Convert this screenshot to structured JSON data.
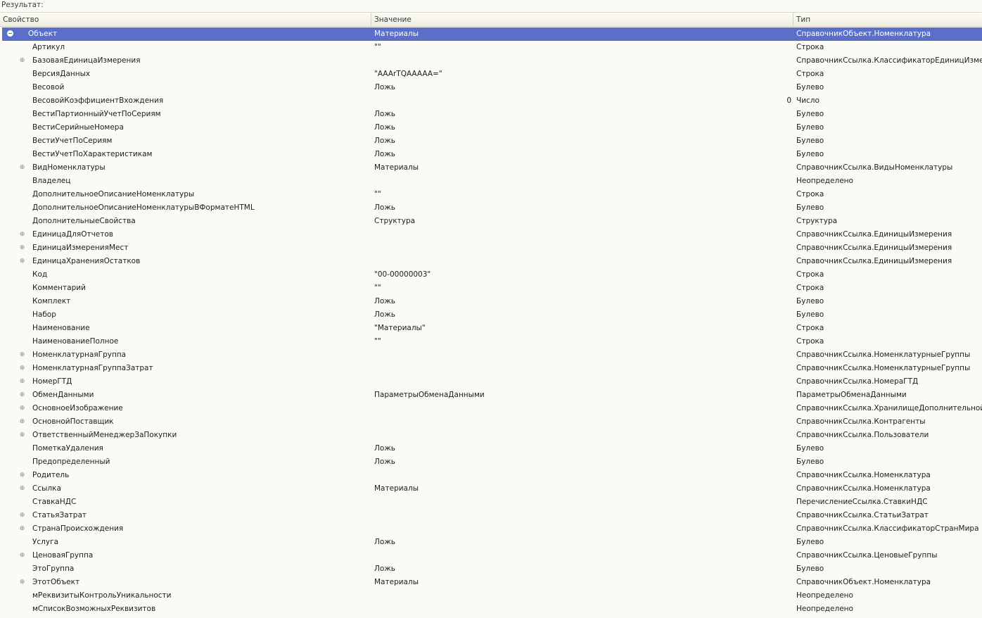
{
  "result_label": "Результат:",
  "columns": {
    "property": "Свойство",
    "value": "Значение",
    "type": "Тип"
  },
  "rows": [
    {
      "prop": "Объект",
      "val": "Материалы",
      "num": "",
      "type": "СправочникОбъект.Номенклатура",
      "expand": "collapse",
      "selected": true
    },
    {
      "prop": "Артикул",
      "val": "\"\"",
      "num": "",
      "type": "Строка",
      "expand": ""
    },
    {
      "prop": "БазоваяЕдиницаИзмерения",
      "val": "",
      "num": "",
      "type": "СправочникСсылка.КлассификаторЕдиницИзмерен",
      "expand": "plus"
    },
    {
      "prop": "ВерсияДанных",
      "val": "\"AAArTQAAAAA=\"",
      "num": "",
      "type": "Строка",
      "expand": ""
    },
    {
      "prop": "Весовой",
      "val": "Ложь",
      "num": "",
      "type": "Булево",
      "expand": ""
    },
    {
      "prop": "ВесовойКоэффициентВхождения",
      "val": "",
      "num": "0",
      "type": "Число",
      "expand": ""
    },
    {
      "prop": "ВестиПартионныйУчетПоСериям",
      "val": "Ложь",
      "num": "",
      "type": "Булево",
      "expand": ""
    },
    {
      "prop": "ВестиСерийныеНомера",
      "val": "Ложь",
      "num": "",
      "type": "Булево",
      "expand": ""
    },
    {
      "prop": "ВестиУчетПоСериям",
      "val": "Ложь",
      "num": "",
      "type": "Булево",
      "expand": ""
    },
    {
      "prop": "ВестиУчетПоХарактеристикам",
      "val": "Ложь",
      "num": "",
      "type": "Булево",
      "expand": ""
    },
    {
      "prop": "ВидНоменклатуры",
      "val": "Материалы",
      "num": "",
      "type": "СправочникСсылка.ВидыНоменклатуры",
      "expand": "plus"
    },
    {
      "prop": "Владелец",
      "val": "",
      "num": "",
      "type": "Неопределено",
      "expand": ""
    },
    {
      "prop": "ДополнительноеОписаниеНоменклатуры",
      "val": "\"\"",
      "num": "",
      "type": "Строка",
      "expand": ""
    },
    {
      "prop": "ДополнительноеОписаниеНоменклатурыВФорматеHTML",
      "val": "Ложь",
      "num": "",
      "type": "Булево",
      "expand": ""
    },
    {
      "prop": "ДополнительныеСвойства",
      "val": "Структура",
      "num": "",
      "type": "Структура",
      "expand": ""
    },
    {
      "prop": "ЕдиницаДляОтчетов",
      "val": "",
      "num": "",
      "type": "СправочникСсылка.ЕдиницыИзмерения",
      "expand": "plus"
    },
    {
      "prop": "ЕдиницаИзмеренияМест",
      "val": "",
      "num": "",
      "type": "СправочникСсылка.ЕдиницыИзмерения",
      "expand": "plus"
    },
    {
      "prop": "ЕдиницаХраненияОстатков",
      "val": "",
      "num": "",
      "type": "СправочникСсылка.ЕдиницыИзмерения",
      "expand": "plus"
    },
    {
      "prop": "Код",
      "val": "\"00-00000003\"",
      "num": "",
      "type": "Строка",
      "expand": ""
    },
    {
      "prop": "Комментарий",
      "val": "\"\"",
      "num": "",
      "type": "Строка",
      "expand": ""
    },
    {
      "prop": "Комплект",
      "val": "Ложь",
      "num": "",
      "type": "Булево",
      "expand": ""
    },
    {
      "prop": "Набор",
      "val": "Ложь",
      "num": "",
      "type": "Булево",
      "expand": ""
    },
    {
      "prop": "Наименование",
      "val": "\"Материалы\"",
      "num": "",
      "type": "Строка",
      "expand": ""
    },
    {
      "prop": "НаименованиеПолное",
      "val": "\"\"",
      "num": "",
      "type": "Строка",
      "expand": ""
    },
    {
      "prop": "НоменклатурнаяГруппа",
      "val": "",
      "num": "",
      "type": "СправочникСсылка.НоменклатурныеГруппы",
      "expand": "plus"
    },
    {
      "prop": "НоменклатурнаяГруппаЗатрат",
      "val": "",
      "num": "",
      "type": "СправочникСсылка.НоменклатурныеГруппы",
      "expand": "plus"
    },
    {
      "prop": "НомерГТД",
      "val": "",
      "num": "",
      "type": "СправочникСсылка.НомераГТД",
      "expand": "plus"
    },
    {
      "prop": "ОбменДанными",
      "val": "ПараметрыОбменаДанными",
      "num": "",
      "type": "ПараметрыОбменаДанными",
      "expand": "plus"
    },
    {
      "prop": "ОсновноеИзображение",
      "val": "",
      "num": "",
      "type": "СправочникСсылка.ХранилищеДополнительнойИнс",
      "expand": "plus"
    },
    {
      "prop": "ОсновнойПоставщик",
      "val": "",
      "num": "",
      "type": "СправочникСсылка.Контрагенты",
      "expand": "plus"
    },
    {
      "prop": "ОтветственныйМенеджерЗаПокупки",
      "val": "",
      "num": "",
      "type": "СправочникСсылка.Пользователи",
      "expand": "plus"
    },
    {
      "prop": "ПометкаУдаления",
      "val": "Ложь",
      "num": "",
      "type": "Булево",
      "expand": ""
    },
    {
      "prop": "Предопределенный",
      "val": "Ложь",
      "num": "",
      "type": "Булево",
      "expand": ""
    },
    {
      "prop": "Родитель",
      "val": "",
      "num": "",
      "type": "СправочникСсылка.Номенклатура",
      "expand": "plus"
    },
    {
      "prop": "Ссылка",
      "val": "Материалы",
      "num": "",
      "type": "СправочникСсылка.Номенклатура",
      "expand": "plus"
    },
    {
      "prop": "СтавкаНДС",
      "val": "",
      "num": "",
      "type": "ПеречислениеСсылка.СтавкиНДС",
      "expand": ""
    },
    {
      "prop": "СтатьяЗатрат",
      "val": "",
      "num": "",
      "type": "СправочникСсылка.СтатьиЗатрат",
      "expand": "plus"
    },
    {
      "prop": "СтранаПроисхождения",
      "val": "",
      "num": "",
      "type": "СправочникСсылка.КлассификаторСтранМира",
      "expand": "plus"
    },
    {
      "prop": "Услуга",
      "val": "Ложь",
      "num": "",
      "type": "Булево",
      "expand": ""
    },
    {
      "prop": "ЦеноваяГруппа",
      "val": "",
      "num": "",
      "type": "СправочникСсылка.ЦеновыеГруппы",
      "expand": "plus"
    },
    {
      "prop": "ЭтоГруппа",
      "val": "Ложь",
      "num": "",
      "type": "Булево",
      "expand": ""
    },
    {
      "prop": "ЭтотОбъект",
      "val": "Материалы",
      "num": "",
      "type": "СправочникОбъект.Номенклатура",
      "expand": "plus"
    },
    {
      "prop": "мРеквизитыКонтрольУникальности",
      "val": "",
      "num": "",
      "type": "Неопределено",
      "expand": ""
    },
    {
      "prop": "мСписокВозможныхРеквизитов",
      "val": "",
      "num": "",
      "type": "Неопределено",
      "expand": ""
    }
  ]
}
